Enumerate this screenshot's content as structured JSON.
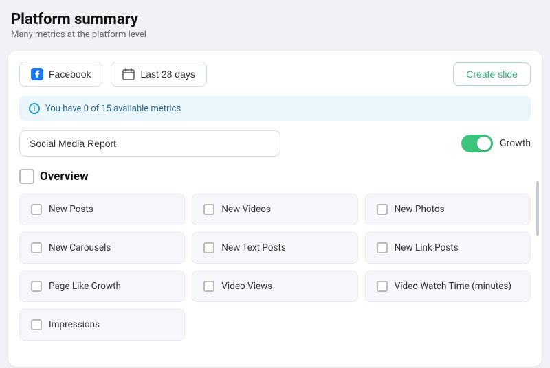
{
  "header": {
    "title": "Platform summary",
    "subtitle": "Many metrics at the platform level"
  },
  "toolbar": {
    "platform_label": "Facebook",
    "date_label": "Last 28 days",
    "create_slide_label": "Create slide"
  },
  "info_banner": {
    "text": "You have 0 of 15 available metrics"
  },
  "report": {
    "input_value": "Social Media Report",
    "toggle_label": "Growth",
    "toggle_on": true
  },
  "overview": {
    "section_title": "Overview",
    "metrics": [
      {
        "label": "New Posts"
      },
      {
        "label": "New Videos"
      },
      {
        "label": "New Photos"
      },
      {
        "label": "New Carousels"
      },
      {
        "label": "New Text Posts"
      },
      {
        "label": "New Link Posts"
      },
      {
        "label": "Page Like Growth"
      },
      {
        "label": "Video Views"
      },
      {
        "label": "Video Watch Time (minutes)"
      },
      {
        "label": "Impressions"
      }
    ]
  }
}
